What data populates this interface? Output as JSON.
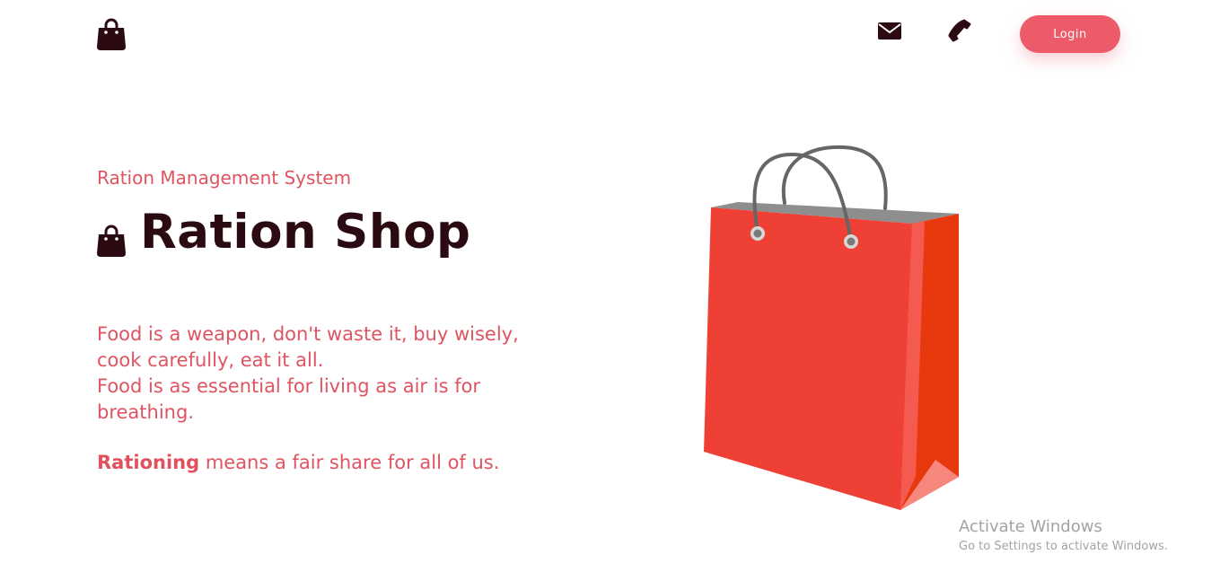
{
  "header": {
    "logo_icon": "shopping-bag-icon",
    "mail_icon": "envelope-icon",
    "phone_icon": "phone-icon",
    "login_label": "Login"
  },
  "hero": {
    "subtitle": "Ration Management System",
    "title_icon": "shopping-bag-icon",
    "title": "Ration Shop",
    "quote_lines": [
      "Food is a weapon, don't waste it, buy wisely,",
      "cook carefully, eat it all.",
      "Food is as essential for living as air is for",
      "breathing."
    ],
    "tagline_bold": "Rationing",
    "tagline_rest": " means a fair share for all of us."
  },
  "illustration": {
    "icon": "red-shopping-bag-illustration"
  },
  "watermark": {
    "title": "Activate Windows",
    "subtitle": "Go to Settings to activate Windows."
  },
  "colors": {
    "accent": "#ed5a6a",
    "text_accent": "#df5460",
    "title_dark": "#2b0a12",
    "bag_red": "#ef4036",
    "bag_side": "#e8390e"
  }
}
